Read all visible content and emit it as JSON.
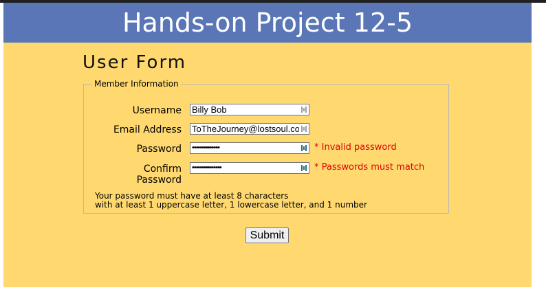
{
  "header": {
    "title": "Hands-on Project 12-5"
  },
  "form": {
    "title": "User Form",
    "legend": "Member Information",
    "fields": {
      "username": {
        "label": "Username",
        "value": "Billy Bob"
      },
      "email": {
        "label": "Email Address",
        "value": "ToTheJourney@lostsoul.com"
      },
      "password": {
        "label": "Password",
        "masked_value": "••••••••••••••",
        "error": "* Invalid password"
      },
      "confirm": {
        "label_line1": "Confirm",
        "label_line2": "Password",
        "masked_value": "•••••••••••••••",
        "error": "* Passwords must match"
      }
    },
    "hint_line1": "Your password must have at least 8 characters",
    "hint_line2": "with at least 1 uppercase letter, 1 lowercase letter, and 1 number",
    "submit_label": "Submit"
  },
  "colors": {
    "header_bg": "#5a76b7",
    "page_bg": "#ffd970",
    "error": "#e00000"
  }
}
